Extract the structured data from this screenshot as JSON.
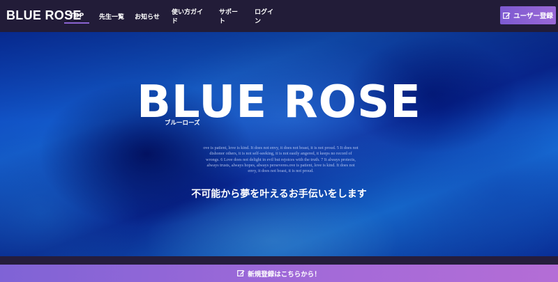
{
  "header": {
    "logo": "BLUE ROSE",
    "nav": [
      {
        "label": "TOP",
        "active": true
      },
      {
        "label": "先生一覧",
        "active": false
      },
      {
        "label": "お知らせ",
        "active": false
      },
      {
        "label": "使い方ガイド",
        "active": false
      },
      {
        "label": "サポート",
        "active": false
      },
      {
        "label": "ログイン",
        "active": false
      }
    ],
    "register_label": "ユーザー登録"
  },
  "hero": {
    "title": "BLUE ROSE",
    "subtitle": "ブルーローズ",
    "quote": "ove is patient, love is kind. It does not envy, it does not boast, it is not proud. 5 It does not dishonor others, it is not self-seeking, it is not easily angered, it keeps no record of wrongs. 6 Love does not delight in evil but rejoices with the truth. 7 It always protects, always trusts, always hopes, always perseveres.ove is patient, love is kind. It does not envy, it does not boast, it is not proud.",
    "tagline": "不可能から夢を叶えるお手伝いをします"
  },
  "bottom": {
    "signup_label": "新規登録はこちらから！"
  },
  "colors": {
    "header_bg": "#221c38",
    "accent": "#8a63d2",
    "button_gradient_start": "#7d5ad1",
    "button_gradient_end": "#b46dd6"
  }
}
